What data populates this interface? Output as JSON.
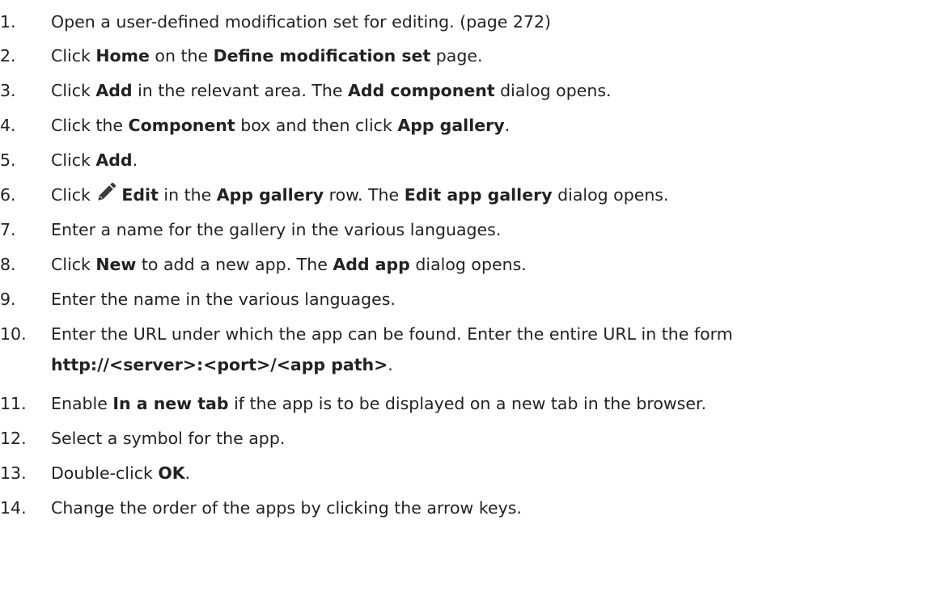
{
  "steps": [
    {
      "number": "1.",
      "parts": [
        {
          "t": "Open a user-defined modification set for editing. (page 272)",
          "b": false
        }
      ]
    },
    {
      "number": "2.",
      "parts": [
        {
          "t": "Click ",
          "b": false
        },
        {
          "t": "Home",
          "b": true
        },
        {
          "t": " on the ",
          "b": false
        },
        {
          "t": "Define modification set",
          "b": true
        },
        {
          "t": " page.",
          "b": false
        }
      ]
    },
    {
      "number": "3.",
      "parts": [
        {
          "t": "Click ",
          "b": false
        },
        {
          "t": "Add",
          "b": true
        },
        {
          "t": " in the relevant area. The ",
          "b": false
        },
        {
          "t": "Add component",
          "b": true
        },
        {
          "t": " dialog opens.",
          "b": false
        }
      ]
    },
    {
      "number": "4.",
      "parts": [
        {
          "t": "Click the ",
          "b": false
        },
        {
          "t": "Component",
          "b": true
        },
        {
          "t": " box and then click ",
          "b": false
        },
        {
          "t": "App gallery",
          "b": true
        },
        {
          "t": ".",
          "b": false
        }
      ]
    },
    {
      "number": "5.",
      "parts": [
        {
          "t": "Click ",
          "b": false
        },
        {
          "t": "Add",
          "b": true
        },
        {
          "t": ".",
          "b": false
        }
      ]
    },
    {
      "number": "6.",
      "parts": [
        {
          "t": "Click ",
          "b": false
        },
        {
          "icon": "pencil-icon"
        },
        {
          "t": "Edit",
          "b": true
        },
        {
          "t": " in the ",
          "b": false
        },
        {
          "t": "App gallery",
          "b": true
        },
        {
          "t": " row. The ",
          "b": false
        },
        {
          "t": "Edit app gallery",
          "b": true
        },
        {
          "t": " dialog opens.",
          "b": false
        }
      ]
    },
    {
      "number": "7.",
      "parts": [
        {
          "t": "Enter a name for the gallery in the various languages.",
          "b": false
        }
      ]
    },
    {
      "number": "8.",
      "parts": [
        {
          "t": "Click ",
          "b": false
        },
        {
          "t": "New",
          "b": true
        },
        {
          "t": " to add a new app. The ",
          "b": false
        },
        {
          "t": "Add app",
          "b": true
        },
        {
          "t": " dialog opens.",
          "b": false
        }
      ]
    },
    {
      "number": "9.",
      "parts": [
        {
          "t": "Enter the name in the various languages.",
          "b": false
        }
      ]
    },
    {
      "number": "10.",
      "parts": [
        {
          "t": "Enter the URL under which the app can be found. Enter the entire URL in the form",
          "b": false
        }
      ],
      "line2": "http://<server>:<port>/<app path>",
      "line2_suffix": "."
    },
    {
      "number": "11.",
      "parts": [
        {
          "t": "Enable ",
          "b": false
        },
        {
          "t": "In a new tab",
          "b": true
        },
        {
          "t": " if the app is to be displayed on a new tab in the browser.",
          "b": false
        }
      ]
    },
    {
      "number": "12.",
      "parts": [
        {
          "t": "Select a symbol for the app.",
          "b": false
        }
      ]
    },
    {
      "number": "13.",
      "parts": [
        {
          "t": "Double-click ",
          "b": false
        },
        {
          "t": "OK",
          "b": true
        },
        {
          "t": ".",
          "b": false
        }
      ]
    },
    {
      "number": "14.",
      "parts": [
        {
          "t": "Change the order of the apps by clicking the arrow keys.",
          "b": false
        }
      ]
    }
  ]
}
